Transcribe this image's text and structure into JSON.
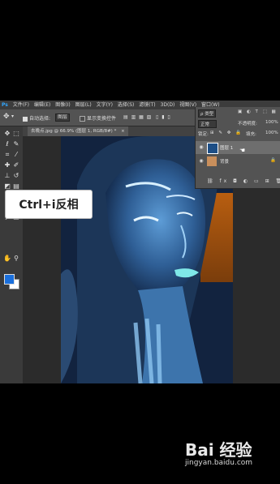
{
  "menubar": {
    "logo": "Ps",
    "items": [
      "文件(F)",
      "编辑(E)",
      "图像(I)",
      "图层(L)",
      "文字(Y)",
      "选择(S)",
      "滤镜(T)",
      "3D(D)",
      "视图(V)",
      "窗口(W)"
    ]
  },
  "options_bar": {
    "auto_select_label": "自动选择:",
    "auto_select_value": "图层",
    "show_transform_label": "显示变换控件"
  },
  "document": {
    "tab_title": "去晚点.jpg @ 66.9% (图层 1, RGB/8#) *",
    "tab_close": "×"
  },
  "tooltip": {
    "text": "Ctrl+i反相"
  },
  "layers_panel": {
    "kind_label": "ρ 类型",
    "blend_mode": "正常",
    "opacity_label": "不透明度:",
    "opacity_value": "100%",
    "lock_label": "锁定:",
    "fill_label": "填充:",
    "fill_value": "100%",
    "layers": [
      {
        "name": "图层 1",
        "selected": true
      },
      {
        "name": "背景",
        "selected": false
      }
    ]
  },
  "colors": {
    "foreground": "#1a6fdc",
    "background": "#ffffff",
    "accent": "#31a8ff"
  },
  "watermark": {
    "brand": "Bai 经验",
    "url": "jingyan.baidu.com"
  }
}
